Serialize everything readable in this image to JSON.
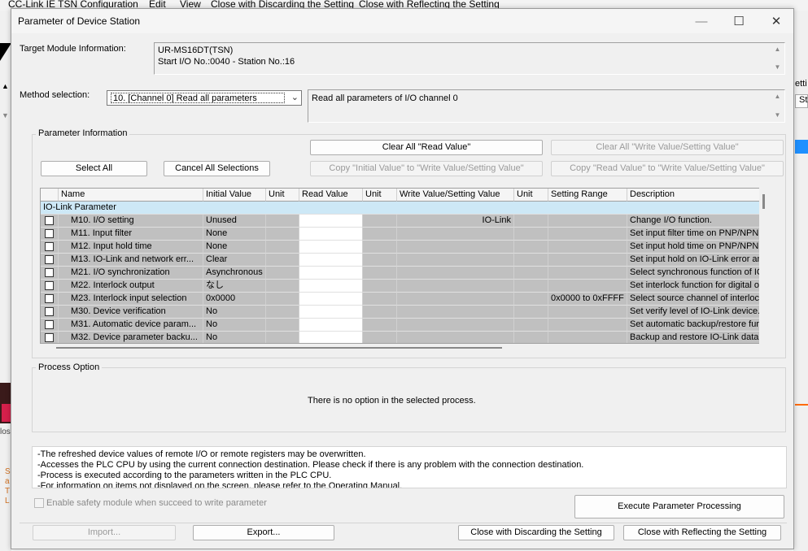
{
  "background": {
    "menubar": [
      "CC-Link IE TSN Configuration",
      "Edit",
      "View",
      "Close with Discarding the Setting",
      "Close with Reflecting the Setting"
    ],
    "right_fragments": [
      "etti",
      "St"
    ],
    "left_fragments": [
      "los",
      "S",
      "a",
      "T",
      "L"
    ]
  },
  "dialog": {
    "title": "Parameter of Device Station",
    "target_label": "Target Module Information:",
    "target_line1": "UR-MS16DT(TSN)",
    "target_line2": "Start I/O No.:0040 - Station No.:16",
    "method_label": "Method selection:",
    "method_value": "10. [Channel 0] Read all parameters",
    "method_description": "Read all parameters of I/O channel 0",
    "param_group_title": "Parameter Information",
    "buttons": {
      "clear_read": "Clear All \"Read Value\"",
      "clear_write": "Clear All \"Write Value/Setting Value\"",
      "select_all": "Select All",
      "cancel_all": "Cancel All Selections",
      "copy_initial": "Copy \"Initial Value\" to \"Write Value/Setting Value\"",
      "copy_read": "Copy \"Read Value\" to \"Write Value/Setting Value\"",
      "execute": "Execute Parameter Processing",
      "import": "Import...",
      "export": "Export...",
      "close_discard": "Close with Discarding the Setting",
      "close_reflect": "Close with Reflecting the Setting"
    },
    "table": {
      "headers": [
        "Name",
        "Initial Value",
        "Unit",
        "Read Value",
        "Unit",
        "Write Value/Setting Value",
        "Unit",
        "Setting Range",
        "Description"
      ],
      "section": "IO-Link Parameter",
      "rows": [
        {
          "name": "M10. I/O setting",
          "initial": "Unused",
          "write": "IO-Link",
          "range": "",
          "desc": "Change I/O function."
        },
        {
          "name": "M11. Input filter",
          "initial": "None",
          "write": "",
          "range": "",
          "desc": "Set input filter time on PNP/NPN in"
        },
        {
          "name": "M12. Input hold time",
          "initial": "None",
          "write": "",
          "range": "",
          "desc": "Set input hold time on PNP/NPN in"
        },
        {
          "name": "M13. IO-Link and network err...",
          "initial": "Clear",
          "write": "",
          "range": "",
          "desc": "Set input hold on IO-Link error an"
        },
        {
          "name": "M21. I/O synchronization",
          "initial": "Asynchronous",
          "write": "",
          "range": "",
          "desc": "Select synchronous function of IC"
        },
        {
          "name": "M22. Interlock output",
          "initial": "なし",
          "write": "",
          "range": "",
          "desc": "Set interlock function for digital ou"
        },
        {
          "name": "M23. Interlock input selection",
          "initial": "0x0000",
          "write": "",
          "range": "0x0000 to 0xFFFF",
          "desc": "Select source channel of interlock"
        },
        {
          "name": "M30. Device verification",
          "initial": "No",
          "write": "",
          "range": "",
          "desc": "Set verify level of IO-Link device."
        },
        {
          "name": "M31. Automatic device param...",
          "initial": "No",
          "write": "",
          "range": "",
          "desc": "Set automatic backup/restore fun"
        },
        {
          "name": "M32. Device parameter backu...",
          "initial": "No",
          "write": "",
          "range": "",
          "desc": "Backup and restore IO-Link data"
        }
      ]
    },
    "process_group_title": "Process Option",
    "process_message": "There is no option in the selected process.",
    "notes": [
      "-The refreshed device values of remote I/O or remote registers may be overwritten.",
      "-Accesses the PLC CPU by using the current connection destination. Please check if there is any problem with the connection destination.",
      "-Process is executed according to the parameters written in the PLC CPU.",
      "-For information on items not displayed on the screen, please refer to the Operating Manual."
    ],
    "safety_checkbox": "Enable safety module when succeed to write parameter"
  }
}
